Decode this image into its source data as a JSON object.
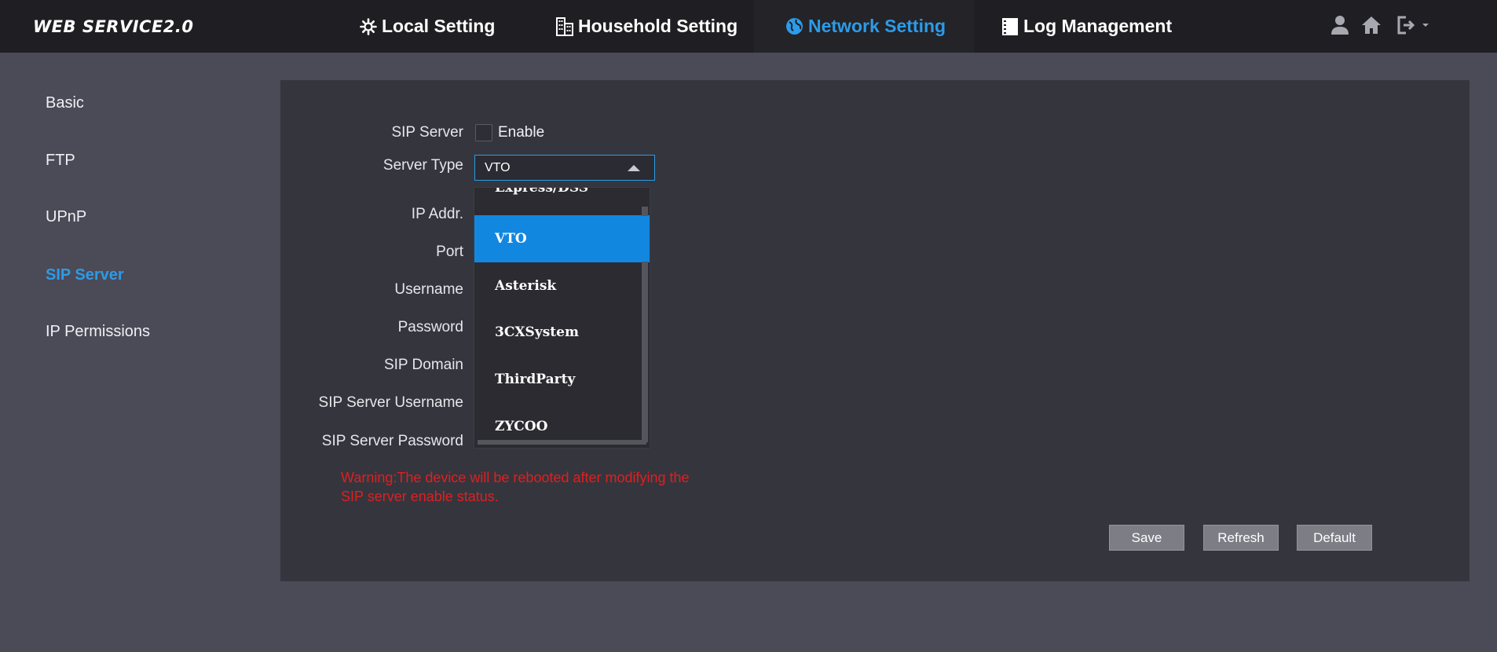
{
  "header": {
    "logo": "WEB SERVICE2.0",
    "tabs": [
      {
        "label": "Local Setting",
        "icon": "gear-icon"
      },
      {
        "label": "Household Setting",
        "icon": "building-icon"
      },
      {
        "label": "Network Setting",
        "icon": "globe-icon"
      },
      {
        "label": "Log Management",
        "icon": "log-icon"
      }
    ],
    "icons": [
      "user-icon",
      "home-icon",
      "logout-icon"
    ]
  },
  "sidebar": {
    "items": [
      {
        "label": "Basic"
      },
      {
        "label": "FTP"
      },
      {
        "label": "UPnP"
      },
      {
        "label": "SIP Server"
      },
      {
        "label": "IP Permissions"
      }
    ]
  },
  "form": {
    "sip_server_label": "SIP Server",
    "enable_label": "Enable",
    "server_type_label": "Server Type",
    "server_type_value": "VTO",
    "ip_addr_label": "IP Addr.",
    "port_label": "Port",
    "username_label": "Username",
    "password_label": "Password",
    "sip_domain_label": "SIP Domain",
    "sip_server_username_label": "SIP Server Username",
    "sip_server_password_label": "SIP Server Password"
  },
  "dropdown": {
    "options": [
      "Express/DSS",
      "VTO",
      "Asterisk",
      "3CXSystem",
      "ThirdParty",
      "ZYCOO"
    ],
    "selected": "VTO"
  },
  "warning": {
    "line1": "Warning:The device will be rebooted after modifying the",
    "line2": "SIP server enable status."
  },
  "buttons": {
    "save": "Save",
    "refresh": "Refresh",
    "default": "Default"
  },
  "colors": {
    "accent": "#2c9be8",
    "selected": "#1287e0",
    "warning": "#e01f1f",
    "topbar": "#1f1f23",
    "background": "#4b4a57",
    "panel": "#35353e"
  }
}
